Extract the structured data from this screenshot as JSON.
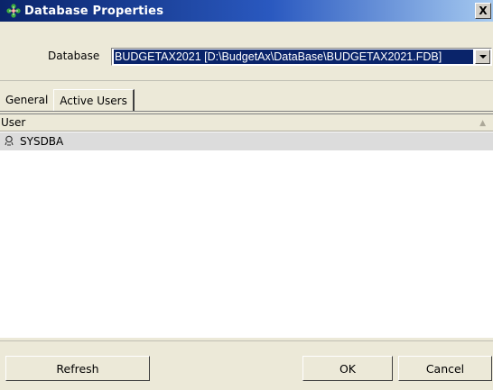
{
  "window": {
    "title": "Database Properties",
    "close_label": "X"
  },
  "database": {
    "label": "Database",
    "selected_value": "BUDGETAX2021 [D:\\BudgetAx\\DataBase\\BUDGETAX2021.FDB]"
  },
  "tabs": [
    {
      "label": "General",
      "active": false
    },
    {
      "label": "Active Users",
      "active": true
    }
  ],
  "table": {
    "columns": [
      "User"
    ],
    "rows": [
      {
        "user": "SYSDBA"
      }
    ]
  },
  "buttons": {
    "refresh": "Refresh",
    "ok": "OK",
    "cancel": "Cancel"
  },
  "colors": {
    "titlebar_start": "#0a246a",
    "selection": "#0a246a",
    "face": "#ece9d8"
  }
}
